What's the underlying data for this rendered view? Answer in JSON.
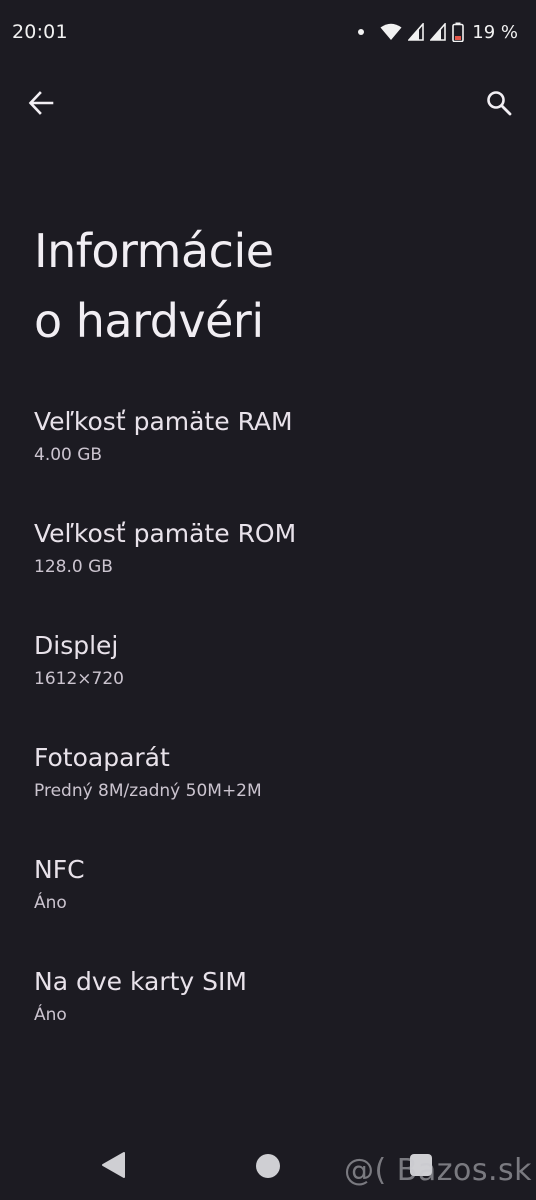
{
  "status_bar": {
    "time": "20:01",
    "battery_text": "19 %",
    "icons": [
      "notification-dot",
      "wifi-icon",
      "signal-icon",
      "signal-icon",
      "battery-icon"
    ]
  },
  "app_bar": {
    "back_icon": "arrow-left-icon",
    "search_icon": "search-icon"
  },
  "page": {
    "title_line1": "Informácie",
    "title_line2": "o hardvéri"
  },
  "items": [
    {
      "label": "Veľkosť pamäte RAM",
      "value": "4.00 GB"
    },
    {
      "label": "Veľkosť pamäte ROM",
      "value": "128.0 GB"
    },
    {
      "label": "Displej",
      "value": "1612×720"
    },
    {
      "label": "Fotoaparát",
      "value": "Predný 8M/zadný 50M+2M"
    },
    {
      "label": "NFC",
      "value": "Áno"
    },
    {
      "label": "Na dve karty SIM",
      "value": "Áno"
    }
  ],
  "watermark": "@( Bazos.sk",
  "colors": {
    "background": "#1c1b22",
    "text_primary": "#e8e2ea",
    "text_secondary": "#cbc4cf",
    "battery_low": "#e4574a"
  }
}
